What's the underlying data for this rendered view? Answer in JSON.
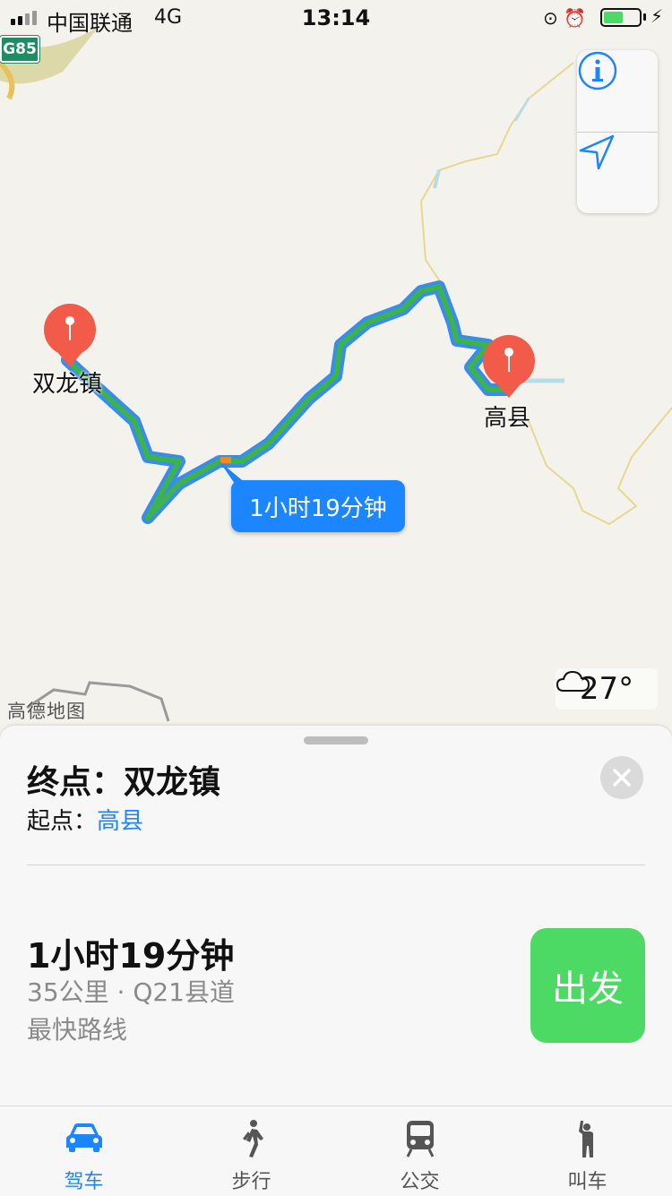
{
  "status_bar": {
    "carrier": "中国联通",
    "network": "4G",
    "time": "13:14",
    "battery_level": 0.55
  },
  "map": {
    "highway_badge": "G85",
    "pins": [
      {
        "label": "双龙镇"
      },
      {
        "label": "高县"
      }
    ],
    "route_callout": "1小时19分钟",
    "weather": {
      "icon": "cloud-icon",
      "temperature": "27°"
    },
    "credit": "高德地图",
    "colors": {
      "route_outline": "#3a8bf0",
      "route_line": "#3cb44a",
      "pin": "#f25a4a"
    }
  },
  "card": {
    "destination_label": "终点：",
    "destination": "双龙镇",
    "origin_label": "起点：",
    "origin": "高县",
    "route": {
      "time": "1小时19分钟",
      "info": "35公里 · Q21县道",
      "note": "最快路线"
    },
    "go_label": "出发"
  },
  "tabs": [
    {
      "label": "驾车",
      "icon": "car-icon",
      "active": true
    },
    {
      "label": "步行",
      "icon": "walk-icon",
      "active": false
    },
    {
      "label": "公交",
      "icon": "train-icon",
      "active": false
    },
    {
      "label": "叫车",
      "icon": "hail-icon",
      "active": false
    }
  ]
}
